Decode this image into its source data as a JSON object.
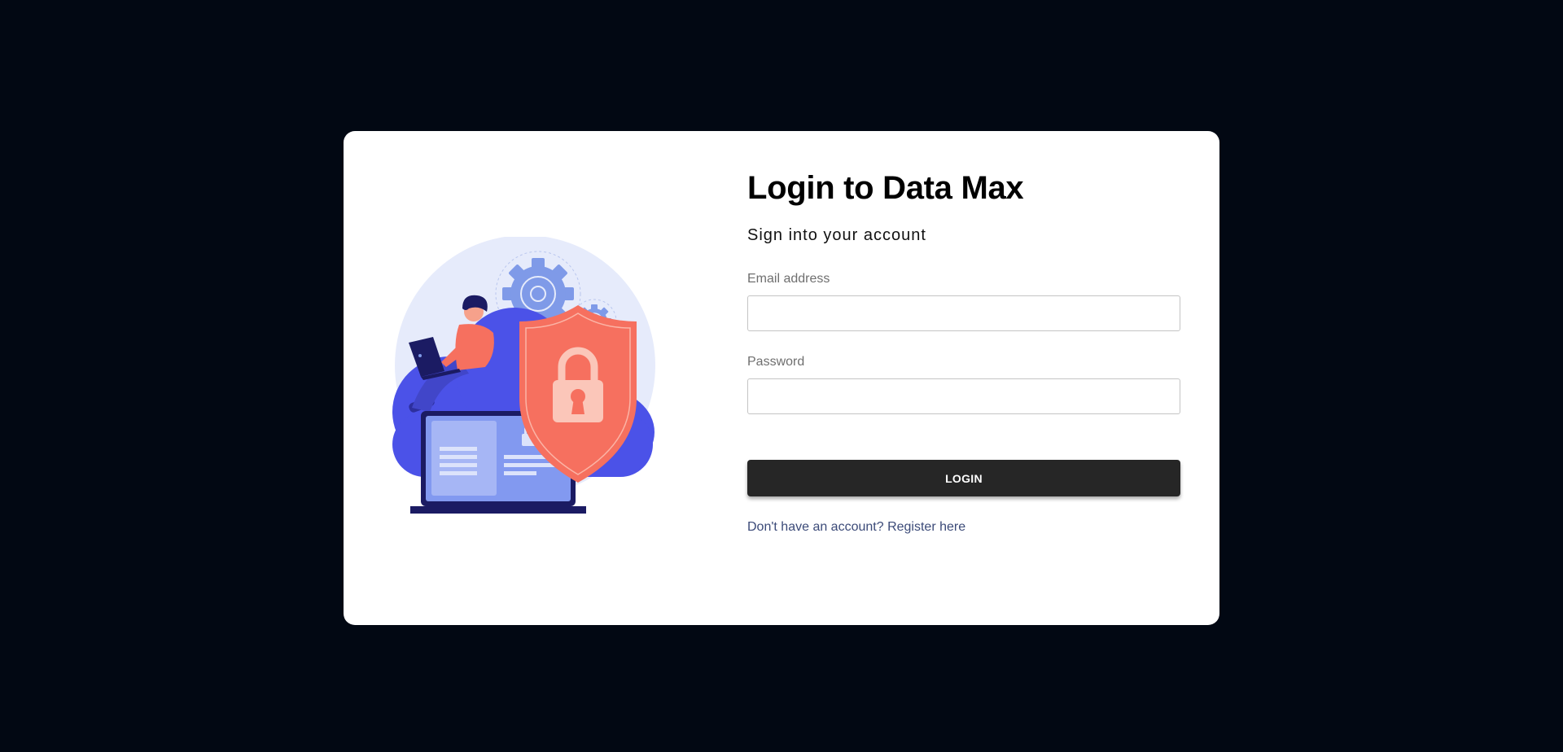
{
  "login": {
    "title": "Login to Data Max",
    "subtitle": "Sign into your account",
    "email_label": "Email address",
    "email_value": "",
    "password_label": "Password",
    "password_value": "",
    "button_label": "LOGIN",
    "register_text": "Don't have an account? Register here"
  },
  "illustration": {
    "name": "cloud-security-illustration"
  },
  "colors": {
    "page_background": "#020813",
    "card_background": "#ffffff",
    "button_background": "#262626",
    "link_color": "#3b4a78",
    "cloud_blue": "#4b52e8",
    "shield_red": "#f6705f"
  }
}
